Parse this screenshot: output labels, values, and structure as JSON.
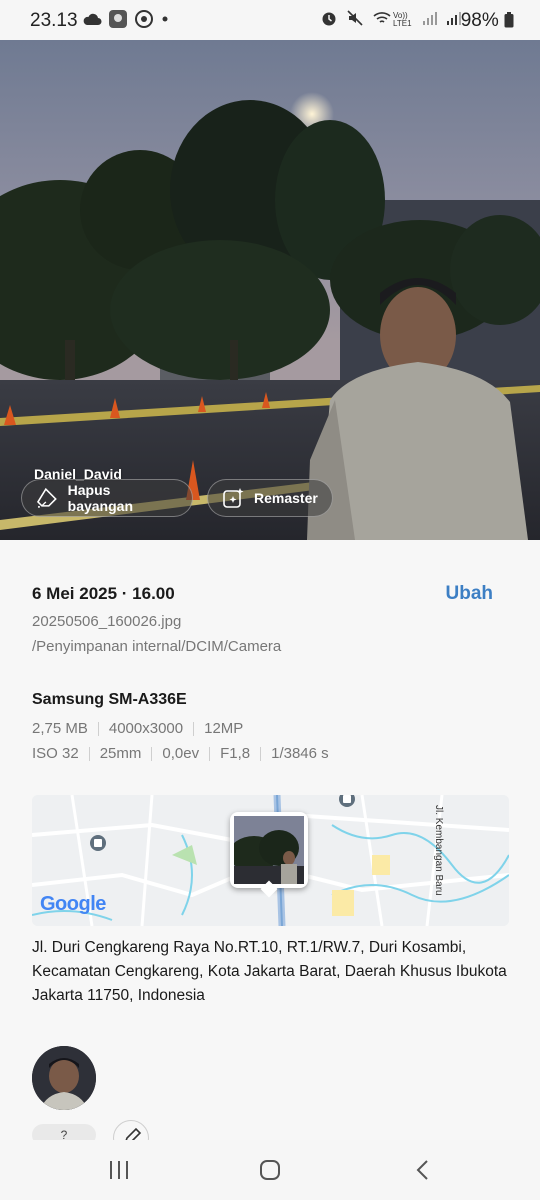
{
  "status_bar": {
    "time": "23.13",
    "battery": "98%",
    "network_label": "LTE1",
    "icons": [
      "cloud-icon",
      "app-icon",
      "sync-icon",
      "dot-icon",
      "alarm-icon",
      "mute-icon",
      "wifi-call-icon",
      "signal-icon",
      "signal-icon",
      "battery-icon"
    ]
  },
  "photo": {
    "person_tag": "Daniel_David",
    "actions": [
      {
        "label": "Hapus bayangan",
        "icon": "eraser-icon"
      },
      {
        "label": "Remaster",
        "icon": "sparkle-icon"
      }
    ]
  },
  "details": {
    "date": "6 Mei 2025 · 16.00",
    "edit_label": "Ubah",
    "filename": "20250506_160026.jpg",
    "path": "/Penyimpanan internal/DCIM/Camera",
    "device": "Samsung SM-A336E",
    "specs_row1": [
      "2,75 MB",
      "4000x3000",
      "12MP"
    ],
    "specs_row2": [
      "ISO 32",
      "25mm",
      "0,0ev",
      "F1,8",
      "1/3846 s"
    ]
  },
  "map": {
    "street_label": "Jl. Kembangan Baru",
    "logo": "Google"
  },
  "location": {
    "address": "Jl. Duri Cengkareng Raya No.RT.10, RT.1/RW.7, Duri Kosambi, Kecamatan Cengkareng, Kota Jakarta Barat, Daerah Khusus Ibukota Jakarta 11750, Indonesia"
  },
  "people": {
    "count_label": "?"
  },
  "nav": {
    "buttons": [
      "recent-apps-icon",
      "home-icon",
      "back-icon"
    ]
  },
  "colors": {
    "accent": "#3d7fc4",
    "background": "#f7f7f7"
  }
}
